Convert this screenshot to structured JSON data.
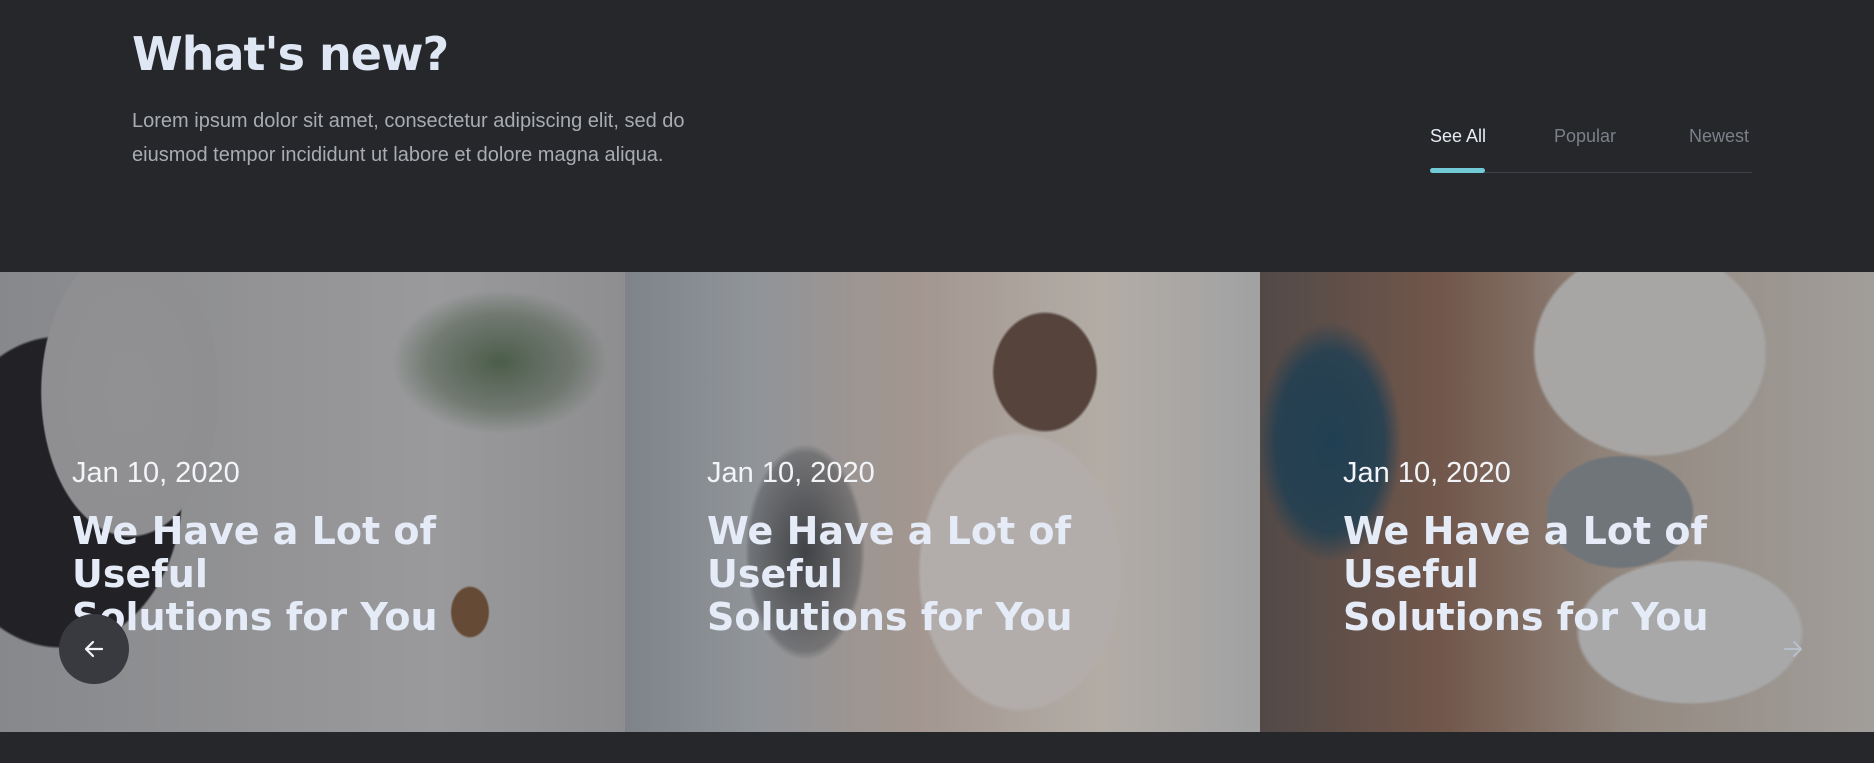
{
  "header": {
    "title": "What's new?",
    "subtitle_line_1": "Lorem ipsum dolor sit amet, consectetur adipiscing elit, sed do",
    "subtitle_line_2": "eiusmod tempor incididunt ut labore et dolore magna aliqua."
  },
  "tabs": [
    {
      "label": "See All",
      "active": true
    },
    {
      "label": "Popular",
      "active": false
    },
    {
      "label": "Newest",
      "active": false
    }
  ],
  "cards": [
    {
      "date": "Jan 10, 2020",
      "title_line_1": "We Have a Lot of Useful",
      "title_line_2": "Solutions for You"
    },
    {
      "date": "Jan 10, 2020",
      "title_line_1": "We Have a Lot of Useful",
      "title_line_2": "Solutions for You"
    },
    {
      "date": "Jan 10, 2020",
      "title_line_1": "We Have a Lot of Useful",
      "title_line_2": "Solutions for You"
    }
  ],
  "controls": {
    "prev_icon": "arrow-left-icon",
    "next_icon": "arrow-right-icon"
  },
  "colors": {
    "background": "#26272a",
    "accent": "#71cad6",
    "heading": "#dfe7f4",
    "muted": "#a8acb3"
  }
}
